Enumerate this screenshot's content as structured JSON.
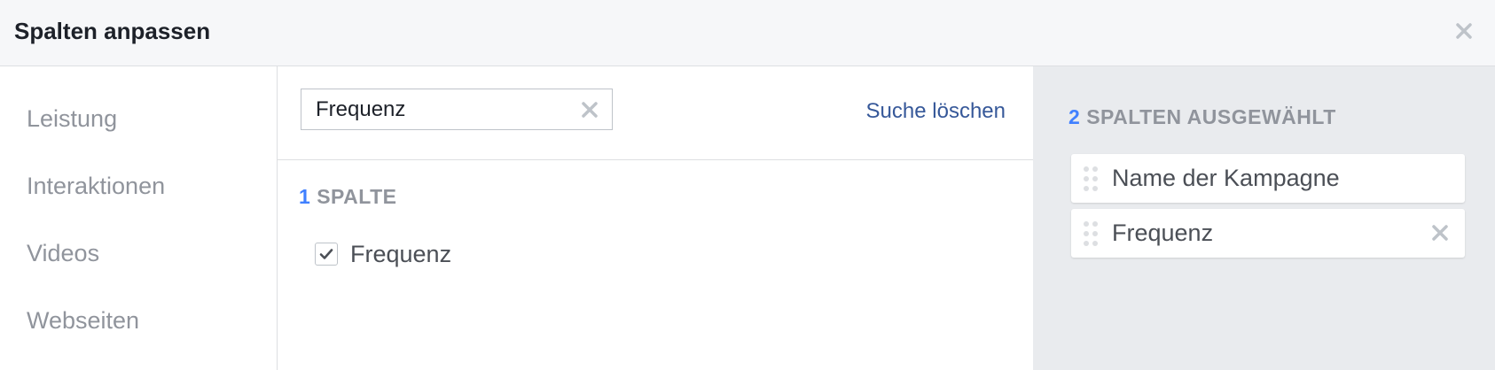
{
  "dialog": {
    "title": "Spalten anpassen"
  },
  "sidebar": {
    "items": [
      {
        "label": "Leistung"
      },
      {
        "label": "Interaktionen"
      },
      {
        "label": "Videos"
      },
      {
        "label": "Webseiten"
      }
    ]
  },
  "search": {
    "value": "Frequenz",
    "clear_link_label": "Suche löschen"
  },
  "results": {
    "count": "1",
    "header_label": "SPALTE",
    "items": [
      {
        "label": "Frequenz",
        "checked": true
      }
    ]
  },
  "selected": {
    "count": "2",
    "header_label": "SPALTEN AUSGEWÄHLT",
    "items": [
      {
        "label": "Name der Kampagne",
        "removable": false
      },
      {
        "label": "Frequenz",
        "removable": true
      }
    ]
  },
  "colors": {
    "accent_count": "#4080ff",
    "link": "#365899",
    "muted_text": "#90949c",
    "panel_bg": "#e9ebee",
    "header_bg": "#f6f7f9"
  },
  "icons": {
    "close": "close-icon",
    "search_clear": "clear-icon",
    "checkbox": "checkmark-icon",
    "drag": "drag-handle-icon",
    "remove": "remove-icon"
  }
}
